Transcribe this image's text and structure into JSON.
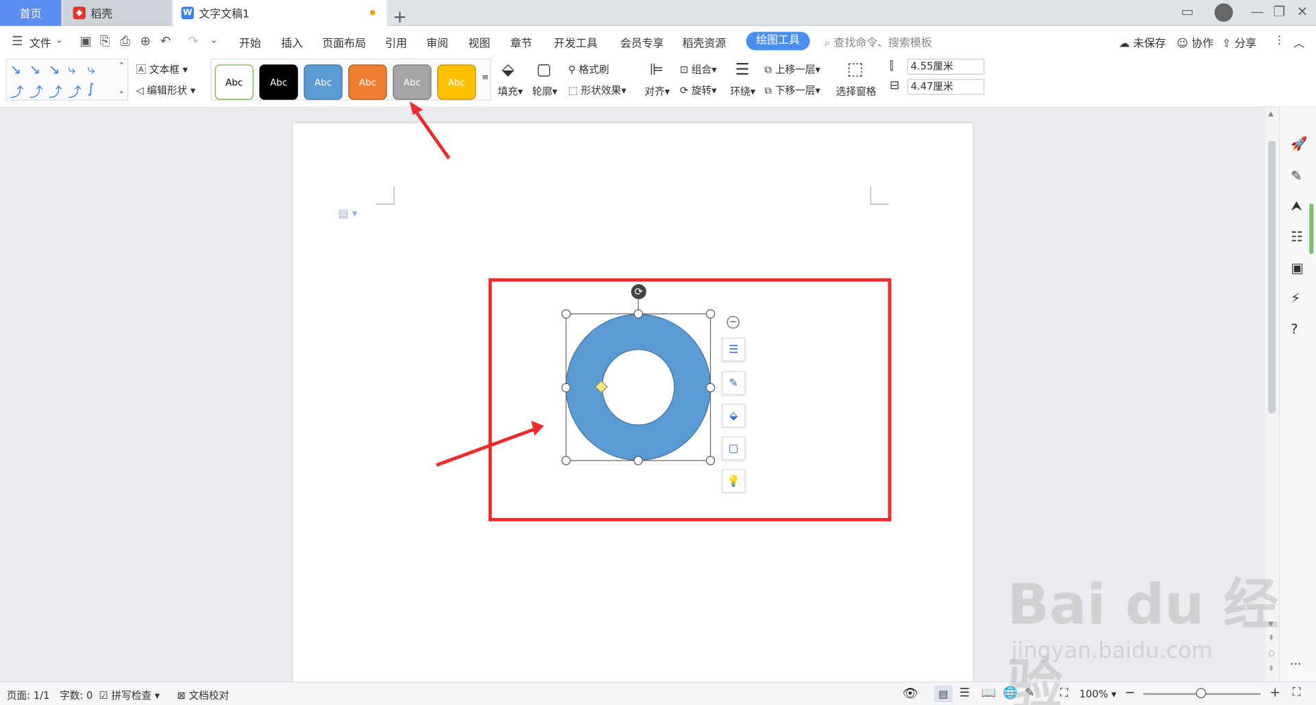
{
  "tabs": {
    "home": "首页",
    "daoke": "稻壳",
    "doc": "文字文稿1",
    "add": "+"
  },
  "menubar": {
    "file": "文件",
    "items": [
      "开始",
      "插入",
      "页面布局",
      "引用",
      "审阅",
      "视图",
      "章节",
      "开发工具",
      "会员专享",
      "稻壳资源"
    ],
    "active": "绘图工具",
    "search": "查找命令、搜索模板",
    "unsaved": "未保存",
    "collab": "协作",
    "share": "分享"
  },
  "ribbon": {
    "textbox": "文本框",
    "edit_shape": "编辑形状",
    "style_label": "Abc",
    "fill": "填充",
    "outline": "轮廓",
    "format_brush": "格式刷",
    "shape_effect": "形状效果",
    "align": "对齐",
    "group": "组合",
    "rotate": "旋转",
    "wrap": "环绕",
    "bring_forward": "上移一层",
    "send_backward": "下移一层",
    "selection_pane": "选择窗格",
    "height": "4.55厘米",
    "width": "4.47厘米"
  },
  "colors": {
    "accent": "#4a8ff0",
    "shape_fill": "#5b9bd5",
    "highlight": "#ee2b2b",
    "style_black": "#000000",
    "style_blue": "#5b9bd5",
    "style_orange": "#ed7d31",
    "style_gray": "#a5a5a5",
    "style_gold": "#ffc000"
  },
  "status": {
    "page": "页面: 1/1",
    "words": "字数: 0",
    "spell": "拼写检查",
    "proof": "文档校对",
    "zoom": "100%"
  },
  "watermark": {
    "brand": "Bai du 经验",
    "url": "jingyan.baidu.com"
  }
}
